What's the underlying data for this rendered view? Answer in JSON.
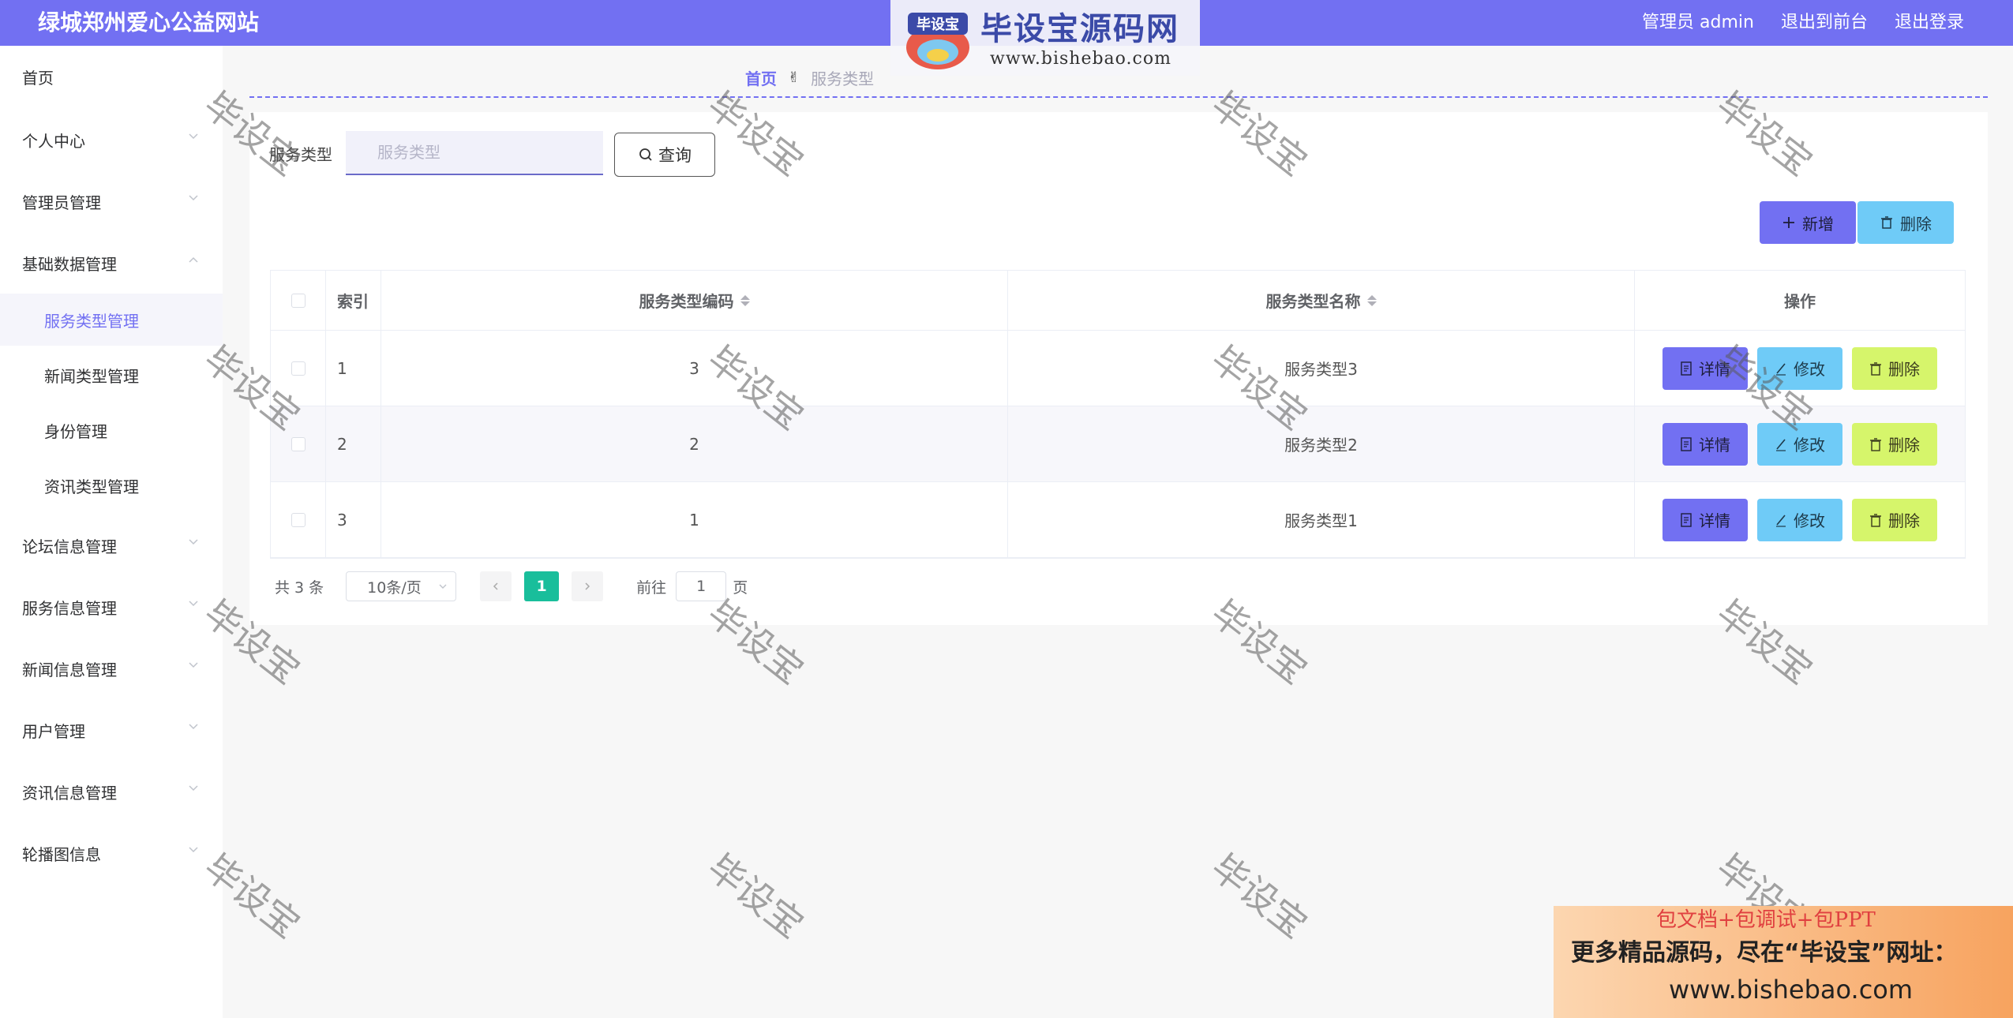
{
  "header": {
    "site_title": "绿城郑州爱心公益网站",
    "user_label": "管理员 admin",
    "front_label": "退出到前台",
    "logout_label": "退出登录"
  },
  "logo": {
    "badge": "毕设宝",
    "name": "毕设宝源码网",
    "url": "www.bishebao.com"
  },
  "sidebar": {
    "items": [
      {
        "label": "首页"
      },
      {
        "label": "个人中心"
      },
      {
        "label": "管理员管理"
      },
      {
        "label": "基础数据管理"
      },
      {
        "label": "服务类型管理"
      },
      {
        "label": "新闻类型管理"
      },
      {
        "label": "身份管理"
      },
      {
        "label": "资讯类型管理"
      },
      {
        "label": "论坛信息管理"
      },
      {
        "label": "服务信息管理"
      },
      {
        "label": "新闻信息管理"
      },
      {
        "label": "用户管理"
      },
      {
        "label": "资讯信息管理"
      },
      {
        "label": "轮播图信息"
      }
    ]
  },
  "breadcrumb": {
    "home": "首页",
    "separator": "✌",
    "current": "服务类型"
  },
  "search": {
    "label": "服务类型",
    "placeholder": "服务类型",
    "button": "查询"
  },
  "toolbar": {
    "add": "新增",
    "delete": "删除"
  },
  "table": {
    "headers": {
      "index": "索引",
      "code": "服务类型编码",
      "name": "服务类型名称",
      "ops": "操作"
    },
    "rows": [
      {
        "index": "1",
        "code": "3",
        "name": "服务类型3"
      },
      {
        "index": "2",
        "code": "2",
        "name": "服务类型2"
      },
      {
        "index": "3",
        "code": "1",
        "name": "服务类型1"
      }
    ],
    "actions": {
      "detail": "详情",
      "edit": "修改",
      "delete": "删除"
    }
  },
  "pagination": {
    "total": "共 3 条",
    "page_size": "10条/页",
    "current_page": "1",
    "goto_label": "前往",
    "goto_value": "1",
    "page_suffix": "页"
  },
  "watermark": "毕设宝",
  "ad": {
    "line1": "包文档+包调试+包PPT",
    "line2": "更多精品源码，尽在“毕设宝”网址：",
    "line3": "www.bishebao.com"
  },
  "colors": {
    "primary": "#7270f2",
    "info": "#6fcbf7",
    "warning": "#d6f56b",
    "pager_active": "#19be9b"
  }
}
